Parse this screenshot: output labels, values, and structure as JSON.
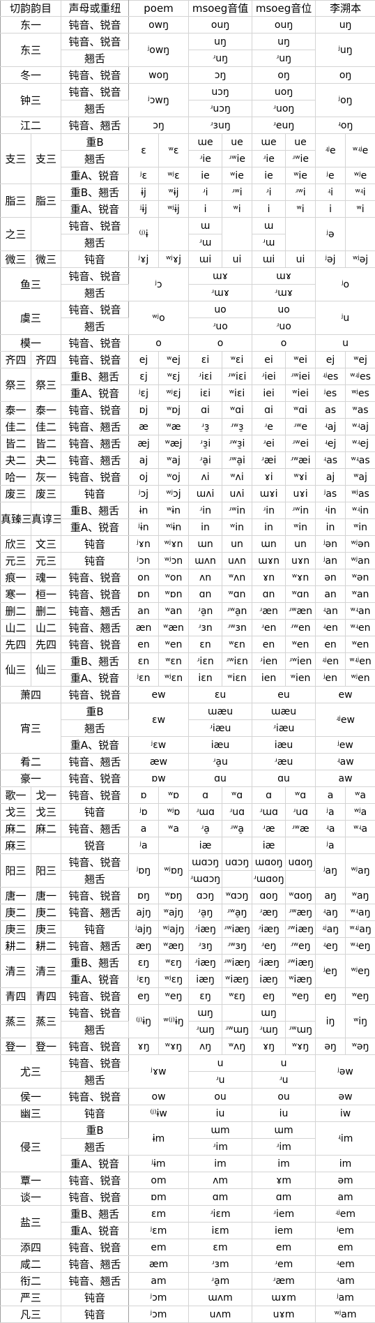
{
  "header": [
    "切韵韵目",
    "声母或重纽",
    "poem",
    "msoeg音值",
    "msoeg音位",
    "李溯本"
  ],
  "rows": [
    [
      [
        "东一",
        1,
        2
      ],
      "钝音、锐音",
      [
        "owŋ",
        1,
        2
      ],
      [
        "ouŋ",
        1,
        2
      ],
      [
        "ouŋ",
        1,
        2
      ],
      [
        "uŋ",
        1,
        2
      ]
    ],
    [
      [
        "东三",
        2,
        2
      ],
      "钝音、锐音",
      [
        "ʲowŋ",
        2,
        2
      ],
      [
        "uŋ",
        1,
        2
      ],
      [
        "uŋ",
        1,
        2
      ],
      [
        "ʲuŋ",
        2,
        2
      ]
    ],
    [
      "翘舌",
      [
        "ʴuŋ",
        1,
        2
      ],
      [
        "ʴuŋ",
        1,
        2
      ]
    ],
    [
      [
        "冬一",
        1,
        2
      ],
      "钝音、锐音",
      [
        "woŋ",
        1,
        2
      ],
      [
        "ɔŋ",
        1,
        2
      ],
      [
        "oŋ",
        1,
        2
      ],
      [
        "oŋ",
        1,
        2
      ]
    ],
    [
      [
        "钟三",
        2,
        2
      ],
      "钝音、锐音",
      [
        "ʲɔwŋ",
        2,
        2
      ],
      [
        "uɔŋ",
        1,
        2
      ],
      [
        "uoŋ",
        1,
        2
      ],
      [
        "ʲoŋ",
        2,
        2
      ]
    ],
    [
      "翘舌",
      [
        "ʴuɔŋ",
        1,
        2
      ],
      [
        "ʴuoŋ",
        1,
        2
      ]
    ],
    [
      [
        "江二",
        1,
        2
      ],
      "钝音、翘舌",
      [
        "ɔŋ",
        1,
        2
      ],
      [
        "ʴɜuŋ",
        1,
        2
      ],
      [
        "ʴeuŋ",
        1,
        2
      ],
      [
        "ʵoŋ",
        1,
        2
      ]
    ],
    [
      [
        "支三",
        3,
        1
      ],
      [
        "支三",
        3,
        1
      ],
      "重B",
      [
        "ɛ",
        2,
        1
      ],
      [
        "ʷɛ",
        2,
        1
      ],
      "ɯe",
      "ue",
      "ɯe",
      "ue",
      [
        "ʵʲe",
        2,
        1
      ],
      [
        "ʷʵʲe",
        2,
        1
      ]
    ],
    [
      "翘舌",
      "ʴie",
      "ʴʷie",
      "ʴie",
      "ʴʷie"
    ],
    [
      "重A、锐音",
      "ʲɛ",
      "ʷʲɛ",
      "ie",
      "ʷie",
      "ie",
      "ʷie",
      "ʲe",
      "ʷʲe"
    ],
    [
      [
        "脂三",
        2,
        1
      ],
      [
        "脂三",
        2,
        1
      ],
      "重B、翘舌",
      "ɨj",
      "ʷɨj",
      "ʴi",
      "ʴʷi",
      "ʴi",
      "ʴʷi",
      "ʵi",
      "ʷʵi"
    ],
    [
      "重A、锐音",
      "ʲɨj",
      "ʷʲɨj",
      "i",
      "ʷi",
      "i",
      "ʷi",
      "i",
      "ʷi"
    ],
    [
      [
        "之三",
        2,
        1
      ],
      [
        "",
        2,
        1
      ],
      "钝音、锐音",
      [
        "⁽ʲ⁾ɨ",
        2,
        1
      ],
      [
        "",
        2,
        1
      ],
      "ɯ",
      [
        "",
        2,
        1
      ],
      "ɯ",
      [
        "",
        2,
        1
      ],
      [
        "ʲə",
        2,
        1
      ],
      [
        "",
        2,
        1
      ]
    ],
    [
      "翘舌",
      "ʴɯ",
      "ʴɯ"
    ],
    [
      "微三",
      "微三",
      "钝音",
      "ʲɤj",
      "ʷʲɤj",
      "ɯi",
      "ui",
      "ɯi",
      "ui",
      "ʲəj",
      "ʷʲəj"
    ],
    [
      [
        "鱼三",
        2,
        2
      ],
      "钝音、锐音",
      [
        "ʲɔ",
        2,
        2
      ],
      [
        "ɯɤ",
        1,
        2
      ],
      [
        "ɯɤ",
        1,
        2
      ],
      [
        "ʲo",
        2,
        2
      ]
    ],
    [
      "翘舌",
      [
        "ʴɯɤ",
        1,
        2
      ],
      [
        "ʴɯɤ",
        1,
        2
      ]
    ],
    [
      [
        "虞三",
        2,
        2
      ],
      "钝音、锐音",
      [
        "ʷʲo",
        2,
        2
      ],
      [
        "uo",
        1,
        2
      ],
      [
        "uo",
        1,
        2
      ],
      [
        "ʲu",
        2,
        2
      ]
    ],
    [
      "翘舌",
      [
        "ʴuo",
        1,
        2
      ],
      [
        "ʴuo",
        1,
        2
      ]
    ],
    [
      [
        "模一",
        1,
        2
      ],
      "钝音、锐音",
      [
        "o",
        1,
        2
      ],
      [
        "o",
        1,
        2
      ],
      [
        "o",
        1,
        2
      ],
      [
        "u",
        1,
        2
      ]
    ],
    [
      "齐四",
      "齐四",
      "钝音、锐音",
      "ej",
      "ʷej",
      "ɛi",
      "ʷɛi",
      "ei",
      "ʷei",
      "ej",
      "ʷej"
    ],
    [
      [
        "祭三",
        2,
        1
      ],
      [
        "祭三",
        2,
        1
      ],
      "重B、翘舌",
      "ɛj",
      "ʷɛj",
      "ʴiɛi",
      "ʴʷiɛi",
      "ʴiei",
      "ʴʷiei",
      "ʵʲes",
      "ʷʵʲes"
    ],
    [
      "重A、锐音",
      "ʲɛj",
      "ʷʲɛj",
      "iɛi",
      "ʷiɛi",
      "iei",
      "ʷiei",
      "ʲes",
      "ʷʲes"
    ],
    [
      "泰一",
      "泰一",
      "钝音、锐音",
      "ɒj",
      "ʷɒj",
      "ɑi",
      "ʷɑi",
      "ɑi",
      "ʷɑi",
      "as",
      "ʷas"
    ],
    [
      "佳二",
      "佳二",
      "钝音、翘舌",
      "æ",
      "ʷæ",
      "ʴɜ̠",
      "ʴʷɜ̠",
      "ʴe",
      "ʴʷe",
      "ʵaj",
      "ʷʵaj"
    ],
    [
      "皆二",
      "皆二",
      "钝音、翘舌",
      "æj",
      "ʷæj",
      "ʴɜ̠i",
      "ʴʷɜ̠i",
      "ʴei",
      "ʴʷei",
      "ʵej",
      "ʷʵej"
    ],
    [
      "夬二",
      "夬二",
      "钝音、翘舌",
      "aj",
      "ʷaj",
      "ʴa̠i",
      "ʴʷa̠i",
      "ʴæi",
      "ʴʷæi",
      "ʵas",
      "ʷʵas"
    ],
    [
      "哈一",
      "灰一",
      "钝音、锐音",
      "oj",
      "ʷoj",
      "ʌi",
      "ʷʌi",
      "ɤi",
      "ʷɤi",
      "aj",
      "ʷaj"
    ],
    [
      "废三",
      "废三",
      "钝音",
      "ʲɔj",
      "ʷʲɔj",
      "ɯʌi",
      "uʌi",
      "ɯɤi",
      "uɤi",
      "ʲas",
      "ʷʲas"
    ],
    [
      [
        "真臻三",
        2,
        1
      ],
      [
        "真谆三",
        2,
        1
      ],
      "重B、翘舌",
      "ɨn",
      "ʷɨn",
      "ʴin",
      "ʴʷin",
      "ʴin",
      "ʴʷin",
      "ʵin",
      "ʷʵin"
    ],
    [
      "重A、锐音",
      "ʲɨn",
      "ʷʲɨn",
      "in",
      "ʷin",
      "in",
      "ʷin",
      "in",
      "ʷin"
    ],
    [
      "欣三",
      "文三",
      "钝音",
      "ʲɤn",
      "ʷʲɤn",
      "ɯn",
      "un",
      "ɯn",
      "un",
      "ʲən",
      "ʷʲən"
    ],
    [
      "元三",
      "元三",
      "钝音",
      "ʲɔn",
      "ʷʲɔn",
      "ɯʌn",
      "uʌn",
      "ɯɤn",
      "uɤn",
      "ʲan",
      "ʷʲan"
    ],
    [
      "痕一",
      "魂一",
      "钝音、锐音",
      "on",
      "ʷon",
      "ʌn",
      "ʷʌn",
      "ɤn",
      "ʷɤn",
      "ən",
      "ʷən"
    ],
    [
      "寒一",
      "桓一",
      "钝音、锐音",
      "ɒn",
      "ʷɒn",
      "ɑn",
      "ʷɑn",
      "ɑn",
      "ʷɑn",
      "an",
      "ʷan"
    ],
    [
      "删二",
      "删二",
      "钝音、翘舌",
      "an",
      "ʷan",
      "ʴa̠n",
      "ʴʷa̠n",
      "ʴæn",
      "ʴʷæn",
      "ʵan",
      "ʷʵan"
    ],
    [
      "山二",
      "山二",
      "钝音、翘舌",
      "æn",
      "ʷæn",
      "ʴɜn",
      "ʴʷɜn",
      "ʴen",
      "ʴʷen",
      "ʵen",
      "ʷʵen"
    ],
    [
      "先四",
      "先四",
      "钝音、锐音",
      "en",
      "ʷen",
      "ɛn",
      "ʷɛn",
      "en",
      "ʷen",
      "en",
      "ʷen"
    ],
    [
      [
        "仙三",
        2,
        1
      ],
      [
        "仙三",
        2,
        1
      ],
      "重B、翘舌",
      "ɛn",
      "ʷɛn",
      "ʴiɛn",
      "ʴʷiɛn",
      "ʴien",
      "ʴʷien",
      "ʵʲen",
      "ʷʵʲen"
    ],
    [
      "重A、锐音",
      "ʲɛn",
      "ʷʲɛn",
      "iɛn",
      "ʷiɛn",
      "ien",
      "ʷien",
      "ʲen",
      "ʷʲen"
    ],
    [
      [
        "萧四",
        1,
        2
      ],
      "钝音、锐音",
      [
        "ew",
        1,
        2
      ],
      [
        "ɛu",
        1,
        2
      ],
      [
        "eu",
        1,
        2
      ],
      [
        "ew",
        1,
        2
      ]
    ],
    [
      [
        "宵三",
        3,
        2
      ],
      "重B",
      [
        "ɛw",
        2,
        2
      ],
      [
        "ɯæu",
        1,
        2
      ],
      [
        "ɯæu",
        1,
        2
      ],
      [
        "ʵʲew",
        2,
        2
      ]
    ],
    [
      "翘舌",
      [
        "ʴiæu",
        1,
        2
      ],
      [
        "ʴiæu",
        1,
        2
      ]
    ],
    [
      "重A、锐音",
      [
        "ʲɛw",
        1,
        2
      ],
      [
        "iæu",
        1,
        2
      ],
      [
        "iæu",
        1,
        2
      ],
      [
        "ʲew",
        1,
        2
      ]
    ],
    [
      [
        "肴二",
        1,
        2
      ],
      "钝音、翘舌",
      [
        "æw",
        1,
        2
      ],
      [
        "ʴa̠u",
        1,
        2
      ],
      [
        "ʴæu",
        1,
        2
      ],
      [
        "ʵaw",
        1,
        2
      ]
    ],
    [
      [
        "豪一",
        1,
        2
      ],
      "钝音、锐音",
      [
        "ɒw",
        1,
        2
      ],
      [
        "ɑu",
        1,
        2
      ],
      [
        "ɑu",
        1,
        2
      ],
      [
        "aw",
        1,
        2
      ]
    ],
    [
      "歌一",
      "戈一",
      "钝音、锐音",
      "ɒ",
      "ʷɒ",
      "ɑ",
      "ʷɑ",
      "ɑ",
      "ʷɑ",
      "a",
      "ʷa"
    ],
    [
      "戈三",
      "戈三",
      "钝音",
      "ʲɒ",
      "ʷʲɒ",
      "ʴɯɑ",
      "ʴuɑ",
      "ʴɯɑ",
      "ʴuɑ",
      "ʲa",
      "ʷʲa"
    ],
    [
      "麻二",
      "麻二",
      "钝音、翘舌",
      "a",
      "ʷa",
      "ʴa̠",
      "ʴʷa̠",
      "ʴæ",
      "ʴʷæ",
      "ʵa",
      "ʷʵa"
    ],
    [
      "麻三",
      "",
      "锐音",
      "ʲa",
      "",
      "iæ",
      "",
      "iæ",
      "",
      "ʲa",
      ""
    ],
    [
      [
        "阳三",
        2,
        1
      ],
      [
        "阳三",
        2,
        1
      ],
      "钝音、锐音",
      [
        "ʲɒŋ",
        2,
        1
      ],
      [
        "ʷʲɒŋ",
        2,
        1
      ],
      "ɯɑɔŋ",
      "uɑɔŋ",
      "ɯɑoŋ",
      "uɑoŋ",
      [
        "ʲaŋ",
        2,
        1
      ],
      [
        "ʷʲaŋ",
        2,
        1
      ]
    ],
    [
      "翘舌",
      "ʴɯɑɔŋ",
      "",
      "ʴɯɑoŋ",
      ""
    ],
    [
      "唐一",
      "唐一",
      "钝音、锐音",
      "ɒŋ",
      "ʷɒŋ",
      "ɑɔŋ",
      "ʷɑɔŋ",
      "ɑoŋ",
      "ʷɑoŋ",
      "aŋ",
      "ʷaŋ"
    ],
    [
      "庚二",
      "庚二",
      "钝音、翘舌",
      "ajŋ",
      "ʷajŋ",
      "ʴa̠ŋ",
      "ʴʷa̠ŋ",
      "ʴæŋ",
      "ʴʷæŋ",
      "ʵaŋ",
      "ʷʵaŋ"
    ],
    [
      "庚三",
      "庚三",
      "钝音",
      "ʲajŋ",
      "ʷʲajŋ",
      "ʴiæŋ",
      "ʴʷiæŋ",
      "ʴiæŋ",
      "ʴʷiæŋ",
      "ʵʲaŋ",
      "ʷʵʲaŋ"
    ],
    [
      "耕二",
      "耕二",
      "钝音、翘舌",
      "æŋ",
      "ʷæŋ",
      "ʴɜŋ",
      "ʴʷɜŋ",
      "ʴeŋ",
      "ʴʷeŋ",
      "ʵeŋ",
      "ʷʵeŋ"
    ],
    [
      [
        "清三",
        2,
        1
      ],
      [
        "清三",
        2,
        1
      ],
      "重B、翘舌",
      "ɛŋ",
      "ʷɛŋ",
      "ʴiæŋ",
      "ʴʷiæŋ",
      "ʴiæŋ",
      "ʴʷiæŋ",
      [
        "ʲeŋ",
        2,
        1
      ],
      [
        "ʷʲeŋ",
        2,
        1
      ]
    ],
    [
      "重A、锐音",
      "ʲɛŋ",
      "ʷʲɛŋ",
      "iæŋ",
      "ʷiæŋ",
      "iæŋ",
      "ʷiæŋ"
    ],
    [
      "青四",
      "青四",
      "钝音、锐音",
      "eŋ",
      "ʷeŋ",
      "ɛŋ",
      "ʷɛŋ",
      "eŋ",
      "ʷeŋ",
      "eŋ",
      "ʷeŋ"
    ],
    [
      [
        "蒸三",
        2,
        1
      ],
      [
        "蒸三",
        2,
        1
      ],
      "钝音、锐音",
      [
        "⁽ʲ⁾ɨŋ",
        2,
        1
      ],
      [
        "ʷ⁽ʲ⁾ɨŋ",
        2,
        1
      ],
      "ɯŋ",
      "",
      "ɯŋ",
      "",
      [
        "iŋ",
        2,
        1
      ],
      [
        "ʷiŋ",
        2,
        1
      ]
    ],
    [
      "翘舌",
      "ʴɯŋ",
      "ʴʷɯŋ",
      "ʴɯŋ",
      "ʴʷɯŋ"
    ],
    [
      "登一",
      "登一",
      "钝音、锐音",
      "ɤŋ",
      "ʷɤŋ",
      "ʌŋ",
      "ʷʌŋ",
      "ɤŋ",
      "ʷɤŋ",
      "əŋ",
      "ʷəŋ"
    ],
    [
      [
        "尤三",
        2,
        2
      ],
      "钝音、锐音",
      [
        "ʲɤw",
        2,
        2
      ],
      [
        "u",
        1,
        2
      ],
      [
        "u",
        1,
        2
      ],
      [
        "ʲəw",
        2,
        2
      ]
    ],
    [
      "翘舌",
      [
        "ʴu",
        1,
        2
      ],
      [
        "ʴu",
        1,
        2
      ]
    ],
    [
      [
        "侯一",
        1,
        2
      ],
      "钝音、锐音",
      [
        "ow",
        1,
        2
      ],
      [
        "ou",
        1,
        2
      ],
      [
        "ou",
        1,
        2
      ],
      [
        "əw",
        1,
        2
      ]
    ],
    [
      [
        "幽三",
        1,
        2
      ],
      "钝音",
      [
        "⁽ʲ⁾ɨw",
        1,
        2
      ],
      [
        "iu",
        1,
        2
      ],
      [
        "iu",
        1,
        2
      ],
      [
        "iw",
        1,
        2
      ]
    ],
    [
      [
        "侵三",
        3,
        2
      ],
      "重B",
      [
        "ɨm",
        2,
        2
      ],
      [
        "ɯm",
        1,
        2
      ],
      [
        "ɯm",
        1,
        2
      ],
      [
        "ʵim",
        2,
        2
      ]
    ],
    [
      "翘舌",
      [
        "ʴim",
        1,
        2
      ],
      [
        "ʴim",
        1,
        2
      ]
    ],
    [
      "重A、锐音",
      [
        "ʲɨm",
        1,
        2
      ],
      [
        "im",
        1,
        2
      ],
      [
        "im",
        1,
        2
      ],
      [
        "im",
        1,
        2
      ]
    ],
    [
      [
        "覃一",
        1,
        2
      ],
      "钝音、锐音",
      [
        "om",
        1,
        2
      ],
      [
        "ʌm",
        1,
        2
      ],
      [
        "ɤm",
        1,
        2
      ],
      [
        "əm",
        1,
        2
      ]
    ],
    [
      [
        "谈一",
        1,
        2
      ],
      "钝音、锐音",
      [
        "ɒm",
        1,
        2
      ],
      [
        "ɑm",
        1,
        2
      ],
      [
        "ɑm",
        1,
        2
      ],
      [
        "am",
        1,
        2
      ]
    ],
    [
      [
        "盐三",
        2,
        2
      ],
      "重B、翘舌",
      [
        "ɛm",
        1,
        2
      ],
      [
        "ʴiɛm",
        1,
        2
      ],
      [
        "ʴiem",
        1,
        2
      ],
      [
        "ʵʲem",
        1,
        2
      ]
    ],
    [
      "重A、锐音",
      [
        "ʲɛm",
        1,
        2
      ],
      [
        "iɛm",
        1,
        2
      ],
      [
        "iem",
        1,
        2
      ],
      [
        "ʲem",
        1,
        2
      ]
    ],
    [
      [
        "添四",
        1,
        2
      ],
      "钝音、锐音",
      [
        "em",
        1,
        2
      ],
      [
        "ɛm",
        1,
        2
      ],
      [
        "em",
        1,
        2
      ],
      [
        "em",
        1,
        2
      ]
    ],
    [
      [
        "咸二",
        1,
        2
      ],
      "钝音、翘舌",
      [
        "æm",
        1,
        2
      ],
      [
        "ʴɜm",
        1,
        2
      ],
      [
        "ʴem",
        1,
        2
      ],
      [
        "ʵem",
        1,
        2
      ]
    ],
    [
      [
        "衔二",
        1,
        2
      ],
      "钝音、翘舌",
      [
        "am",
        1,
        2
      ],
      [
        "ʴa̠m",
        1,
        2
      ],
      [
        "ʴæm",
        1,
        2
      ],
      [
        "ʵam",
        1,
        2
      ]
    ],
    [
      [
        "严三",
        1,
        2
      ],
      "钝音",
      [
        "ʲɔm",
        1,
        2
      ],
      [
        "ɯʌm",
        1,
        2
      ],
      [
        "ɯɤm",
        1,
        2
      ],
      [
        "ʲam",
        1,
        2
      ]
    ],
    [
      [
        "凡三",
        1,
        2
      ],
      "钝音",
      [
        "ʲɔm",
        1,
        2
      ],
      [
        "uʌm",
        1,
        2
      ],
      [
        "uɤm",
        1,
        2
      ],
      [
        "ʷʲam",
        1,
        2
      ]
    ]
  ]
}
